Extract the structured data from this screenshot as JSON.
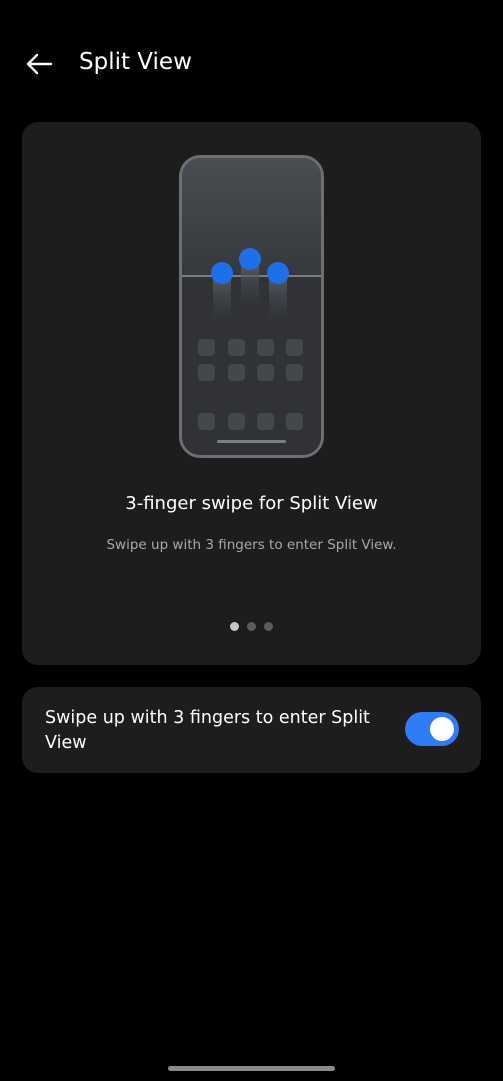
{
  "header": {
    "title": "Split View",
    "back_icon": "arrow-left-icon"
  },
  "tutorial": {
    "illustration_icon": "three-finger-swipe-illustration",
    "title": "3-finger swipe for Split View",
    "description": "Swipe up with 3 fingers to enter Split View.",
    "pager": {
      "count": 3,
      "active_index": 0
    }
  },
  "setting": {
    "label": "Swipe up with 3 fingers to enter Split View",
    "enabled": true
  },
  "colors": {
    "background": "#000000",
    "card": "#1d1d1d",
    "accent": "#2f7cf6",
    "secondary_text": "#a8a8a8"
  }
}
